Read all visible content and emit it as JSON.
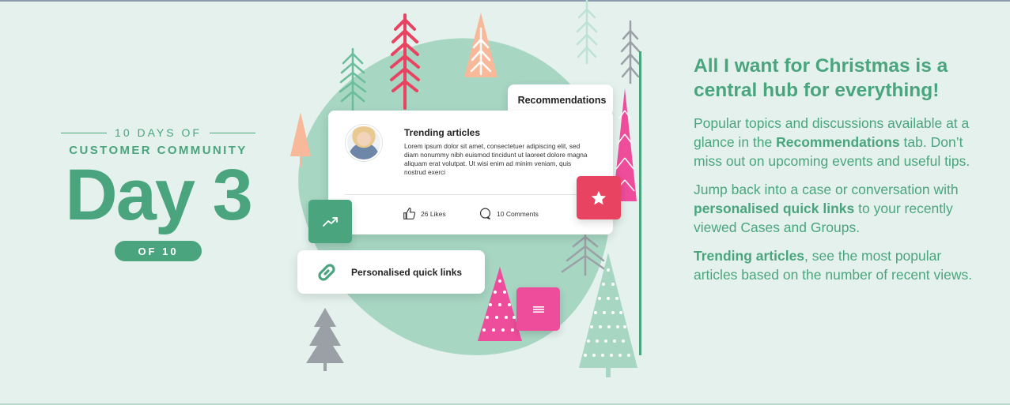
{
  "left": {
    "kicker": "10 DAYS OF",
    "subkicker": "CUSTOMER COMMUNITY",
    "day": "Day 3",
    "of_label": "OF 10"
  },
  "card": {
    "tab_label": "Recommendations",
    "title": "Trending articles",
    "body": "Lorem ipsum dolor sit amet, consectetuer adipiscing elit, sed diam nonummy nibh euismod tincidunt ut laoreet dolore magna aliquam erat volutpat. Ut wisi enim ad minim veniam, quis nostrud exerci",
    "likes": "26 Likes",
    "comments": "10 Comments",
    "quick_links": "Personalised quick links"
  },
  "right": {
    "headline": "All I want for Christmas is a central hub for everything!",
    "p1_a": "Popular topics and discussions available at a glance in the ",
    "p1_bold": "Recommendations",
    "p1_b": " tab. Don’t miss out on upcoming events and useful tips.",
    "p2_a": "Jump back into a case or conversation with ",
    "p2_bold": "personalised quick links",
    "p2_b": " to your recently viewed Cases and Groups.",
    "p3_bold": "Trending articles",
    "p3_b": ", see the most popular articles based on the number of recent views."
  },
  "colors": {
    "background": "#e4f1ec",
    "green": "#4aa57f",
    "red": "#e84360",
    "pink": "#ee4d9b",
    "peach": "#f7b999",
    "grey": "#9aa0a6"
  },
  "icons": [
    "trending-up-icon",
    "star-icon",
    "menu-icon",
    "link-icon",
    "thumbs-up-icon",
    "comment-icon"
  ]
}
